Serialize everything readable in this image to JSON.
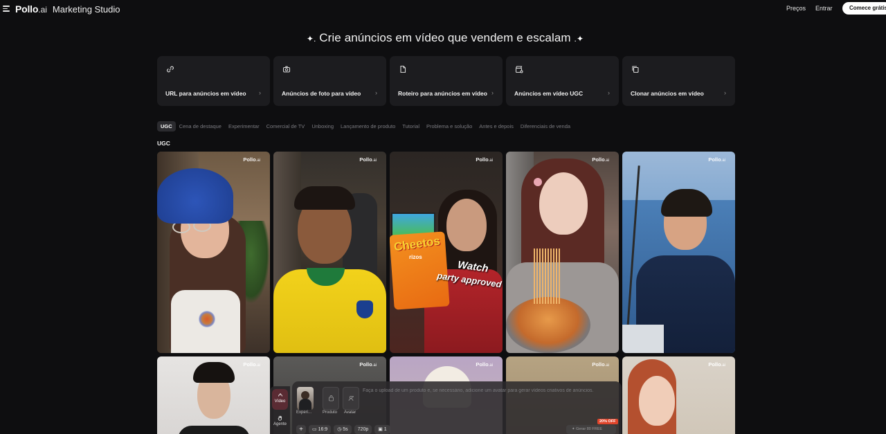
{
  "header": {
    "logo": "Pollo",
    "logo_suffix": ".ai",
    "studio": "Marketing Studio",
    "nav": {
      "pricing": "Preços",
      "login": "Entrar"
    },
    "cta": "Comece grátis"
  },
  "hero": {
    "sparkle_left": "✦.",
    "title": "Crie anúncios em vídeo que vendem e escalam",
    "sparkle_right": ".✦"
  },
  "cards": [
    {
      "label": "URL para anúncios em vídeo",
      "icon": "link-icon"
    },
    {
      "label": "Anúncios de foto para vídeo",
      "icon": "camera-icon"
    },
    {
      "label": "Roteiro para anúncios em vídeo",
      "icon": "document-icon"
    },
    {
      "label": "Anúncios em vídeo UGC",
      "icon": "clapperboard-icon"
    },
    {
      "label": "Clonar anúncios em vídeo",
      "icon": "copy-icon"
    }
  ],
  "card_chevron": "›",
  "tabs": [
    "UGC",
    "Cena de destaque",
    "Experimentar",
    "Comercial de TV",
    "Unboxing",
    "Lançamento de produto",
    "Tutorial",
    "Problema e solução",
    "Antes e depois",
    "Diferenciais de venda"
  ],
  "active_tab": "UGC",
  "section_title": "UGC",
  "watermark": {
    "brand": "Pollo",
    "suffix": ".ai"
  },
  "video_overlay_text": {
    "line1": "Watch",
    "line2": "party approved",
    "product": "Cheetos",
    "product_sub": "rizos"
  },
  "side_nav": {
    "video": "Vídeo",
    "agent": "Agente"
  },
  "composer": {
    "thumb_experiment": "Experi...",
    "thumb_product": "Produto",
    "thumb_avatar": "Avatar",
    "placeholder": "Faça o upload de um produto e, se necessário, adicione um avatar para gerar vídeos criativos de anúncios.",
    "discount": "20% OFF",
    "add": "+",
    "ratio": "16:9",
    "duration": "5s",
    "resolution": "720p",
    "count": "1",
    "generate": "Gerar",
    "generate_cost": "80 FREE"
  }
}
